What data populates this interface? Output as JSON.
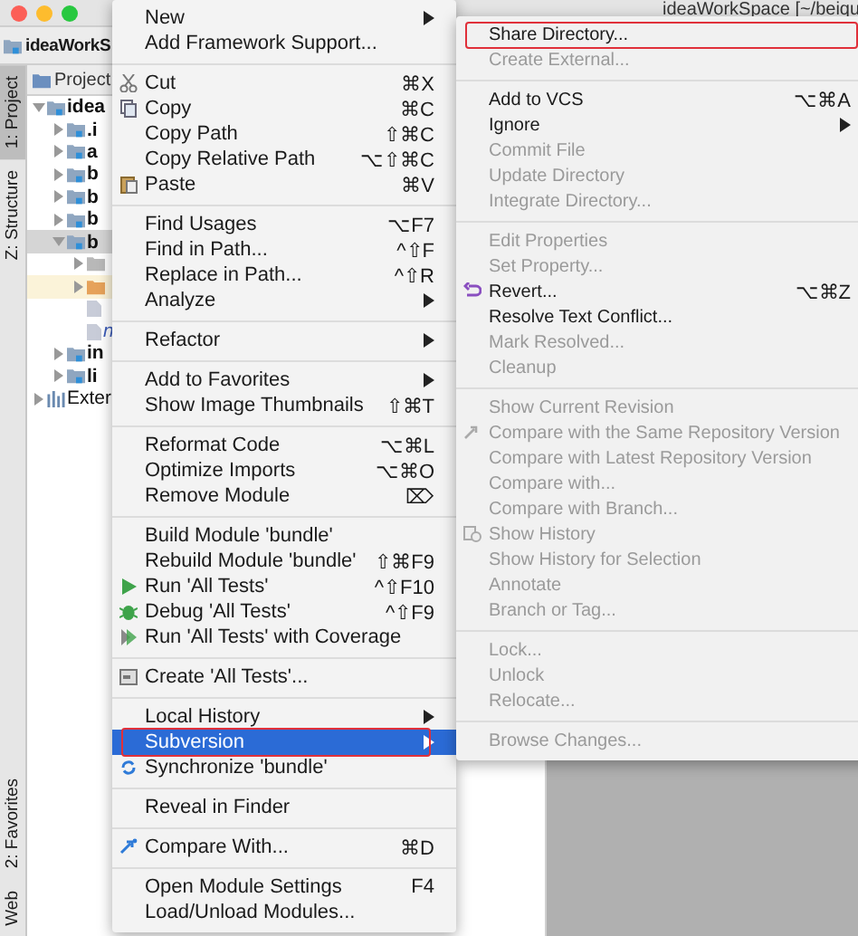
{
  "window": {
    "title": "ideaWorkSpace [~/beiqu"
  },
  "toolbar": {
    "project": "ideaWorkS"
  },
  "tool_strip": {
    "top": [
      {
        "label": "1: Project",
        "selected": true
      },
      {
        "label": "Z: Structure",
        "selected": false
      }
    ],
    "bottom": [
      {
        "label": "2: Favorites",
        "selected": false
      },
      {
        "label": "Web",
        "selected": false
      }
    ]
  },
  "project_panel": {
    "header": "Project",
    "tree": [
      {
        "label": "idea",
        "expanded": true,
        "selected": false,
        "children": [
          {
            "label": ".i",
            "expanded": false,
            "selected": false
          },
          {
            "label": "a",
            "expanded": false,
            "selected": false
          },
          {
            "label": "b",
            "expanded": false,
            "selected": false
          },
          {
            "label": "b",
            "expanded": false,
            "selected": false
          },
          {
            "label": "b",
            "expanded": false,
            "selected": false
          },
          {
            "label": "b",
            "expanded": true,
            "selected": true,
            "children": [
              {
                "kind": "folder",
                "expanded": false,
                "selected": false
              },
              {
                "kind": "folder-orange",
                "expanded": false,
                "selected": false,
                "highlighted": true
              },
              {
                "kind": "file",
                "selected": false
              },
              {
                "kind": "file",
                "label": "n",
                "selected": false
              }
            ]
          },
          {
            "label": "in",
            "expanded": false,
            "selected": false
          },
          {
            "label": "li",
            "expanded": false,
            "selected": false
          }
        ]
      },
      {
        "label": "Exter",
        "kind": "library",
        "expanded": false,
        "selected": false
      }
    ]
  },
  "context_menu": {
    "sections": [
      [
        {
          "label": "New",
          "submenu": true,
          "disabled": false,
          "selected": false,
          "outlined": false
        },
        {
          "label": "Add Framework Support...",
          "disabled": false,
          "selected": false,
          "outlined": false
        }
      ],
      [
        {
          "label": "Cut",
          "shortcut": "⌘X",
          "disabled": false,
          "selected": false,
          "outlined": false
        },
        {
          "label": "Copy",
          "shortcut": "⌘C",
          "disabled": false,
          "selected": false,
          "outlined": false
        },
        {
          "label": "Copy Path",
          "shortcut": "⇧⌘C",
          "disabled": false,
          "selected": false,
          "outlined": false
        },
        {
          "label": "Copy Relative Path",
          "shortcut": "⌥⇧⌘C",
          "disabled": false,
          "selected": false,
          "outlined": false
        },
        {
          "label": "Paste",
          "shortcut": "⌘V",
          "disabled": false,
          "selected": false,
          "outlined": false
        }
      ],
      [
        {
          "label": "Find Usages",
          "shortcut": "⌥F7",
          "disabled": false,
          "selected": false,
          "outlined": false
        },
        {
          "label": "Find in Path...",
          "shortcut": "^⇧F",
          "disabled": false,
          "selected": false,
          "outlined": false
        },
        {
          "label": "Replace in Path...",
          "shortcut": "^⇧R",
          "disabled": false,
          "selected": false,
          "outlined": false
        },
        {
          "label": "Analyze",
          "submenu": true,
          "disabled": false,
          "selected": false,
          "outlined": false
        }
      ],
      [
        {
          "label": "Refactor",
          "submenu": true,
          "disabled": false,
          "selected": false,
          "outlined": false
        }
      ],
      [
        {
          "label": "Add to Favorites",
          "submenu": true,
          "disabled": false,
          "selected": false,
          "outlined": false
        },
        {
          "label": "Show Image Thumbnails",
          "shortcut": "⇧⌘T",
          "disabled": false,
          "selected": false,
          "outlined": false
        }
      ],
      [
        {
          "label": "Reformat Code",
          "shortcut": "⌥⌘L",
          "disabled": false,
          "selected": false,
          "outlined": false
        },
        {
          "label": "Optimize Imports",
          "shortcut": "⌥⌘O",
          "disabled": false,
          "selected": false,
          "outlined": false
        },
        {
          "label": "Remove Module",
          "shortcut": "⌦",
          "disabled": false,
          "selected": false,
          "outlined": false
        }
      ],
      [
        {
          "label": "Build Module 'bundle'",
          "disabled": false,
          "selected": false,
          "outlined": false
        },
        {
          "label": "Rebuild Module 'bundle'",
          "shortcut": "⇧⌘F9",
          "disabled": false,
          "selected": false,
          "outlined": false
        },
        {
          "label": "Run 'All Tests'",
          "shortcut": "^⇧F10",
          "disabled": false,
          "selected": false,
          "outlined": false
        },
        {
          "label": "Debug 'All Tests'",
          "shortcut": "^⇧F9",
          "disabled": false,
          "selected": false,
          "outlined": false
        },
        {
          "label": "Run 'All Tests' with Coverage",
          "disabled": false,
          "selected": false,
          "outlined": false
        }
      ],
      [
        {
          "label": "Create 'All Tests'...",
          "disabled": false,
          "selected": false,
          "outlined": false
        }
      ],
      [
        {
          "label": "Local History",
          "submenu": true,
          "disabled": false,
          "selected": false,
          "outlined": false
        },
        {
          "label": "Subversion",
          "submenu": true,
          "disabled": false,
          "selected": true,
          "outlined": true
        },
        {
          "label": "Synchronize 'bundle'",
          "disabled": false,
          "selected": false,
          "outlined": false
        }
      ],
      [
        {
          "label": "Reveal in Finder",
          "disabled": false,
          "selected": false,
          "outlined": false
        }
      ],
      [
        {
          "label": "Compare With...",
          "shortcut": "⌘D",
          "disabled": false,
          "selected": false,
          "outlined": false
        }
      ],
      [
        {
          "label": "Open Module Settings",
          "shortcut": "F4",
          "disabled": false,
          "selected": false,
          "outlined": false
        },
        {
          "label": "Load/Unload Modules...",
          "disabled": false,
          "selected": false,
          "outlined": false
        }
      ]
    ]
  },
  "submenu": {
    "sections": [
      [
        {
          "label": "Share Directory...",
          "disabled": false,
          "selected": false,
          "outlined": true
        },
        {
          "label": "Create External...",
          "disabled": true,
          "selected": false,
          "outlined": false
        }
      ],
      [
        {
          "label": "Add to VCS",
          "shortcut": "⌥⌘A",
          "disabled": false,
          "selected": false,
          "outlined": false
        },
        {
          "label": "Ignore",
          "submenu": true,
          "disabled": false,
          "selected": false,
          "outlined": false
        },
        {
          "label": "Commit File",
          "disabled": true,
          "selected": false,
          "outlined": false
        },
        {
          "label": "Update Directory",
          "disabled": true,
          "selected": false,
          "outlined": false
        },
        {
          "label": "Integrate Directory...",
          "disabled": true,
          "selected": false,
          "outlined": false
        }
      ],
      [
        {
          "label": "Edit Properties",
          "disabled": true,
          "selected": false,
          "outlined": false
        },
        {
          "label": "Set Property...",
          "disabled": true,
          "selected": false,
          "outlined": false
        },
        {
          "label": "Revert...",
          "shortcut": "⌥⌘Z",
          "disabled": false,
          "selected": false,
          "outlined": false
        },
        {
          "label": "Resolve Text Conflict...",
          "disabled": false,
          "selected": false,
          "outlined": false
        },
        {
          "label": "Mark Resolved...",
          "disabled": true,
          "selected": false,
          "outlined": false
        },
        {
          "label": "Cleanup",
          "disabled": true,
          "selected": false,
          "outlined": false
        }
      ],
      [
        {
          "label": "Show Current Revision",
          "disabled": true,
          "selected": false,
          "outlined": false
        },
        {
          "label": "Compare with the Same Repository Version",
          "disabled": true,
          "selected": false,
          "outlined": false
        },
        {
          "label": "Compare with Latest Repository Version",
          "disabled": true,
          "selected": false,
          "outlined": false
        },
        {
          "label": "Compare with...",
          "disabled": true,
          "selected": false,
          "outlined": false
        },
        {
          "label": "Compare with Branch...",
          "disabled": true,
          "selected": false,
          "outlined": false
        },
        {
          "label": "Show History",
          "disabled": true,
          "selected": false,
          "outlined": false
        },
        {
          "label": "Show History for Selection",
          "disabled": true,
          "selected": false,
          "outlined": false
        },
        {
          "label": "Annotate",
          "disabled": true,
          "selected": false,
          "outlined": false
        },
        {
          "label": "Branch or Tag...",
          "disabled": true,
          "selected": false,
          "outlined": false
        }
      ],
      [
        {
          "label": "Lock...",
          "disabled": true,
          "selected": false,
          "outlined": false
        },
        {
          "label": "Unlock",
          "disabled": true,
          "selected": false,
          "outlined": false
        },
        {
          "label": "Relocate...",
          "disabled": true,
          "selected": false,
          "outlined": false
        }
      ],
      [
        {
          "label": "Browse Changes...",
          "disabled": true,
          "selected": false,
          "outlined": false
        }
      ]
    ]
  }
}
